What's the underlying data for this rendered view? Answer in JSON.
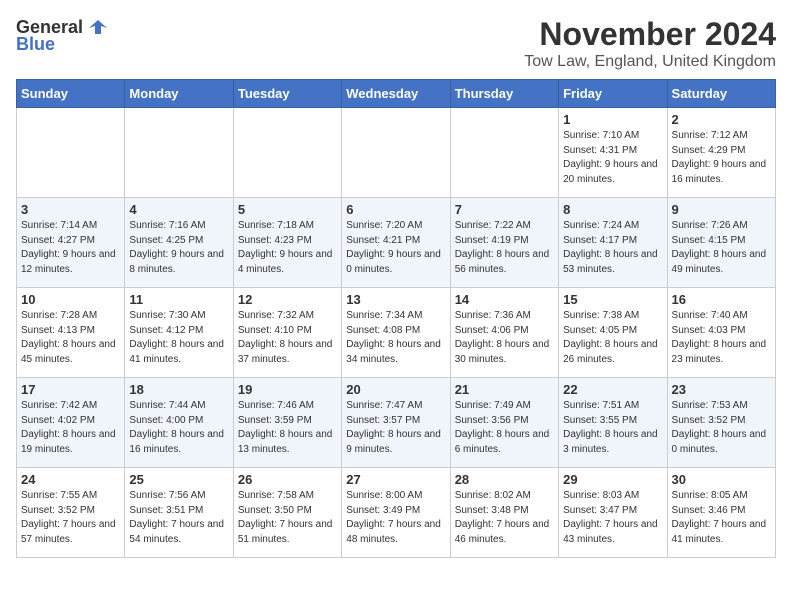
{
  "logo": {
    "general": "General",
    "blue": "Blue"
  },
  "title": "November 2024",
  "location": "Tow Law, England, United Kingdom",
  "days_of_week": [
    "Sunday",
    "Monday",
    "Tuesday",
    "Wednesday",
    "Thursday",
    "Friday",
    "Saturday"
  ],
  "weeks": [
    [
      {
        "day": "",
        "info": ""
      },
      {
        "day": "",
        "info": ""
      },
      {
        "day": "",
        "info": ""
      },
      {
        "day": "",
        "info": ""
      },
      {
        "day": "",
        "info": ""
      },
      {
        "day": "1",
        "info": "Sunrise: 7:10 AM\nSunset: 4:31 PM\nDaylight: 9 hours and 20 minutes."
      },
      {
        "day": "2",
        "info": "Sunrise: 7:12 AM\nSunset: 4:29 PM\nDaylight: 9 hours and 16 minutes."
      }
    ],
    [
      {
        "day": "3",
        "info": "Sunrise: 7:14 AM\nSunset: 4:27 PM\nDaylight: 9 hours and 12 minutes."
      },
      {
        "day": "4",
        "info": "Sunrise: 7:16 AM\nSunset: 4:25 PM\nDaylight: 9 hours and 8 minutes."
      },
      {
        "day": "5",
        "info": "Sunrise: 7:18 AM\nSunset: 4:23 PM\nDaylight: 9 hours and 4 minutes."
      },
      {
        "day": "6",
        "info": "Sunrise: 7:20 AM\nSunset: 4:21 PM\nDaylight: 9 hours and 0 minutes."
      },
      {
        "day": "7",
        "info": "Sunrise: 7:22 AM\nSunset: 4:19 PM\nDaylight: 8 hours and 56 minutes."
      },
      {
        "day": "8",
        "info": "Sunrise: 7:24 AM\nSunset: 4:17 PM\nDaylight: 8 hours and 53 minutes."
      },
      {
        "day": "9",
        "info": "Sunrise: 7:26 AM\nSunset: 4:15 PM\nDaylight: 8 hours and 49 minutes."
      }
    ],
    [
      {
        "day": "10",
        "info": "Sunrise: 7:28 AM\nSunset: 4:13 PM\nDaylight: 8 hours and 45 minutes."
      },
      {
        "day": "11",
        "info": "Sunrise: 7:30 AM\nSunset: 4:12 PM\nDaylight: 8 hours and 41 minutes."
      },
      {
        "day": "12",
        "info": "Sunrise: 7:32 AM\nSunset: 4:10 PM\nDaylight: 8 hours and 37 minutes."
      },
      {
        "day": "13",
        "info": "Sunrise: 7:34 AM\nSunset: 4:08 PM\nDaylight: 8 hours and 34 minutes."
      },
      {
        "day": "14",
        "info": "Sunrise: 7:36 AM\nSunset: 4:06 PM\nDaylight: 8 hours and 30 minutes."
      },
      {
        "day": "15",
        "info": "Sunrise: 7:38 AM\nSunset: 4:05 PM\nDaylight: 8 hours and 26 minutes."
      },
      {
        "day": "16",
        "info": "Sunrise: 7:40 AM\nSunset: 4:03 PM\nDaylight: 8 hours and 23 minutes."
      }
    ],
    [
      {
        "day": "17",
        "info": "Sunrise: 7:42 AM\nSunset: 4:02 PM\nDaylight: 8 hours and 19 minutes."
      },
      {
        "day": "18",
        "info": "Sunrise: 7:44 AM\nSunset: 4:00 PM\nDaylight: 8 hours and 16 minutes."
      },
      {
        "day": "19",
        "info": "Sunrise: 7:46 AM\nSunset: 3:59 PM\nDaylight: 8 hours and 13 minutes."
      },
      {
        "day": "20",
        "info": "Sunrise: 7:47 AM\nSunset: 3:57 PM\nDaylight: 8 hours and 9 minutes."
      },
      {
        "day": "21",
        "info": "Sunrise: 7:49 AM\nSunset: 3:56 PM\nDaylight: 8 hours and 6 minutes."
      },
      {
        "day": "22",
        "info": "Sunrise: 7:51 AM\nSunset: 3:55 PM\nDaylight: 8 hours and 3 minutes."
      },
      {
        "day": "23",
        "info": "Sunrise: 7:53 AM\nSunset: 3:52 PM\nDaylight: 8 hours and 0 minutes."
      }
    ],
    [
      {
        "day": "24",
        "info": "Sunrise: 7:55 AM\nSunset: 3:52 PM\nDaylight: 7 hours and 57 minutes."
      },
      {
        "day": "25",
        "info": "Sunrise: 7:56 AM\nSunset: 3:51 PM\nDaylight: 7 hours and 54 minutes."
      },
      {
        "day": "26",
        "info": "Sunrise: 7:58 AM\nSunset: 3:50 PM\nDaylight: 7 hours and 51 minutes."
      },
      {
        "day": "27",
        "info": "Sunrise: 8:00 AM\nSunset: 3:49 PM\nDaylight: 7 hours and 48 minutes."
      },
      {
        "day": "28",
        "info": "Sunrise: 8:02 AM\nSunset: 3:48 PM\nDaylight: 7 hours and 46 minutes."
      },
      {
        "day": "29",
        "info": "Sunrise: 8:03 AM\nSunset: 3:47 PM\nDaylight: 7 hours and 43 minutes."
      },
      {
        "day": "30",
        "info": "Sunrise: 8:05 AM\nSunset: 3:46 PM\nDaylight: 7 hours and 41 minutes."
      }
    ]
  ]
}
